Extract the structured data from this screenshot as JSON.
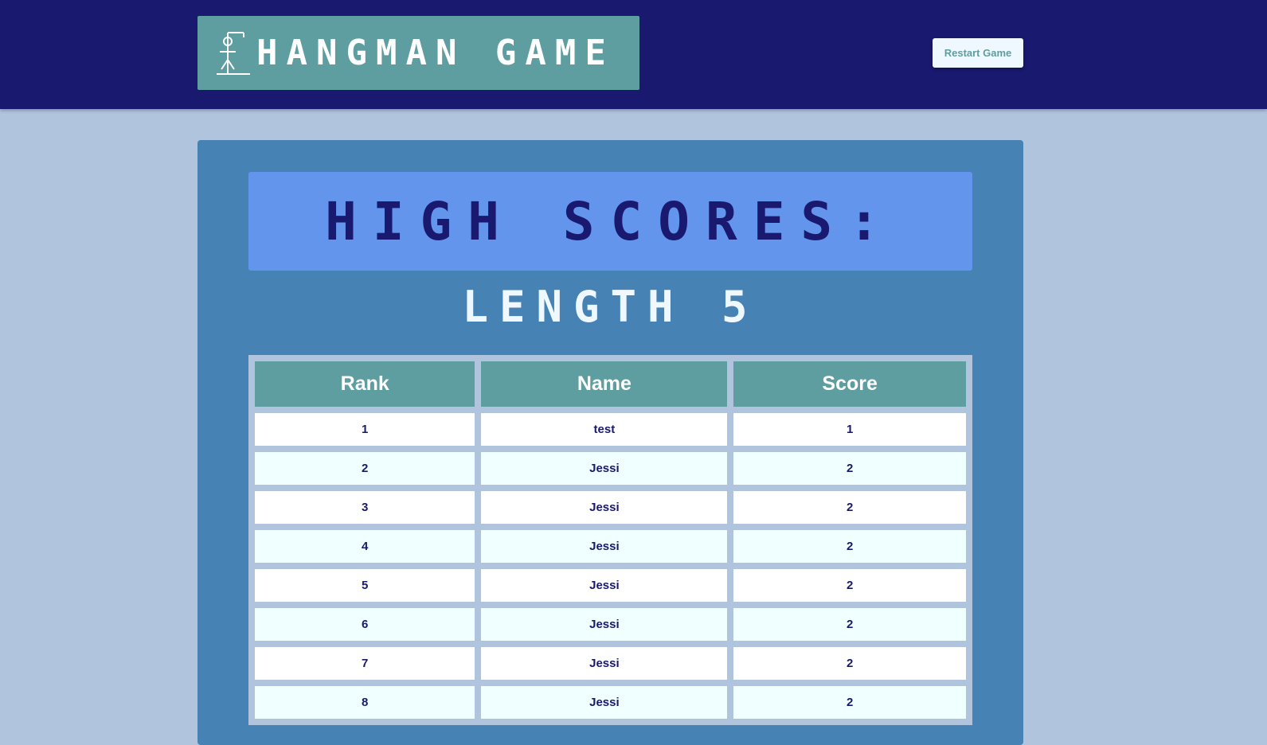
{
  "header": {
    "title": "HANGMAN GAME",
    "logo_icon": "hangman-gallows-icon",
    "restart_label": "Restart Game"
  },
  "main": {
    "banner_title": "HIGH SCORES:",
    "subtitle": "LENGTH 5",
    "table": {
      "columns": [
        "Rank",
        "Name",
        "Score"
      ],
      "rows": [
        {
          "rank": "1",
          "name": "test",
          "score": "1"
        },
        {
          "rank": "2",
          "name": "Jessi",
          "score": "2"
        },
        {
          "rank": "3",
          "name": "Jessi",
          "score": "2"
        },
        {
          "rank": "4",
          "name": "Jessi",
          "score": "2"
        },
        {
          "rank": "5",
          "name": "Jessi",
          "score": "2"
        },
        {
          "rank": "6",
          "name": "Jessi",
          "score": "2"
        },
        {
          "rank": "7",
          "name": "Jessi",
          "score": "2"
        },
        {
          "rank": "8",
          "name": "Jessi",
          "score": "2"
        }
      ]
    }
  },
  "colors": {
    "header_bg": "#191970",
    "page_bg": "#b0c4de",
    "logo_bg": "#5f9ea0",
    "panel_bg": "#4682b4",
    "banner_bg": "#6495ed",
    "table_header_bg": "#5f9ea0",
    "row_alt_bg": "#f0ffff"
  }
}
